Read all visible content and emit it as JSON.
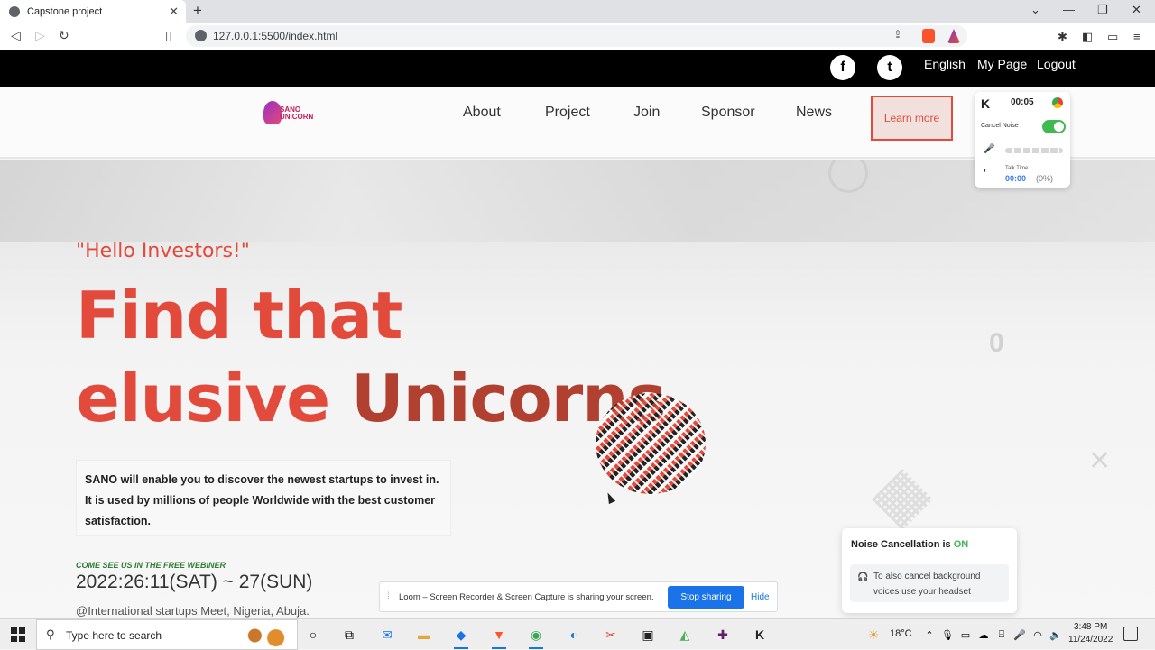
{
  "browser": {
    "tab_title": "Capstone project",
    "tab_close": "✕",
    "new_tab": "+",
    "url": "127.0.0.1:5500/index.html",
    "window_controls": [
      "⌄",
      "—",
      "❐",
      "✕"
    ]
  },
  "site_top": {
    "social": [
      {
        "icon": "f"
      },
      {
        "icon": "t"
      }
    ],
    "links": [
      "English",
      "My Page",
      "Logout"
    ]
  },
  "nav": {
    "logo_text": "SANO UNICORN",
    "links": [
      "About",
      "Project",
      "Join",
      "Sponsor",
      "News"
    ],
    "cta": "Learn more"
  },
  "krisp": {
    "logo": "K",
    "time": "00:05",
    "cancel_noise": "Cancel Noise",
    "cancel_noise_on": true,
    "talk_time_label": "Talk Time",
    "talk_time_value": "00:00",
    "talk_time_pct": "(0%)"
  },
  "hero": {
    "greeting": "\"Hello Investors!\"",
    "headline_line1": "Find that",
    "headline_line2a": "elusive ",
    "headline_line2b": "Unicorns",
    "description": "SANO will enable you to discover the newest startups to invest in. It is used by millions of people Worldwide with the best customer satisfaction.",
    "webinar_label": "COME SEE US IN THE FREE WEBINER",
    "date": "2022:26:11(SAT) ~ 27(SUN)",
    "venue": "@International startups Meet, Nigeria, Abuja."
  },
  "noise_popup": {
    "title": "Noise Cancellation is ",
    "state": "ON",
    "hint": "To also cancel background voices use your headset"
  },
  "loom": {
    "message": "Loom – Screen Recorder & Screen Capture is sharing your screen.",
    "stop": "Stop sharing",
    "hide": "Hide"
  },
  "taskbar": {
    "search_placeholder": "Type here to search",
    "weather": "18°C",
    "time": "3:48 PM",
    "date": "11/24/2022"
  },
  "colors": {
    "accent": "#e24a3b",
    "topbar": "#000000",
    "toggle_on": "#3fb950",
    "loom_button": "#1a73e8"
  }
}
